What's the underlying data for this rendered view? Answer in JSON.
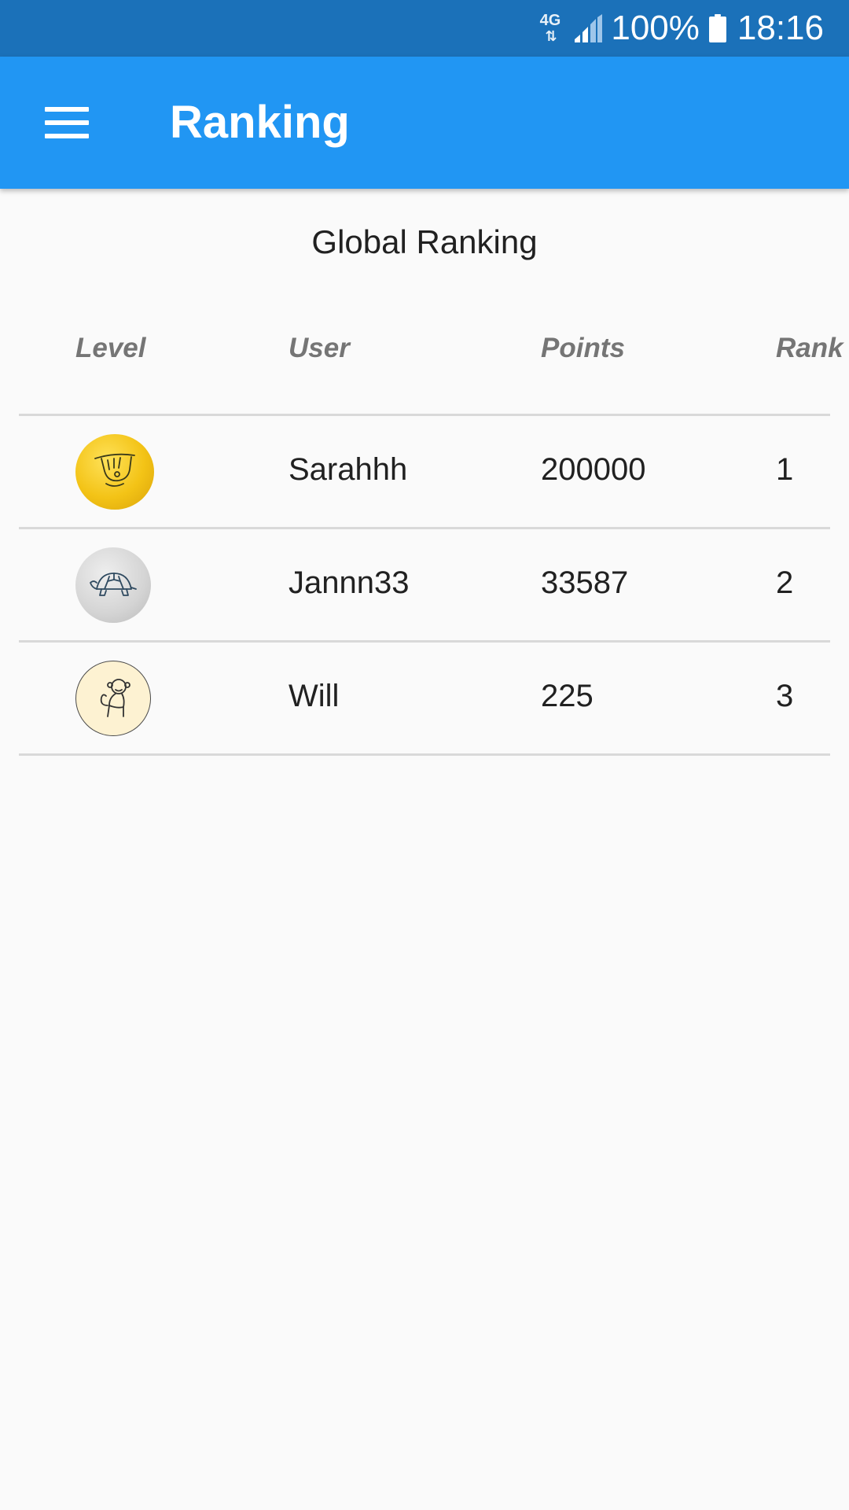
{
  "status_bar": {
    "network": "4G",
    "battery": "100%",
    "time": "18:16"
  },
  "app_bar": {
    "title": "Ranking",
    "menu_icon": "hamburger-menu-icon"
  },
  "section_title": "Global Ranking",
  "table": {
    "columns": [
      "Level",
      "User",
      "Points",
      "Rank"
    ],
    "rows": [
      {
        "level_icon": "sloth-icon",
        "level_color": "#f3c316",
        "user": "Sarahhh",
        "points": "200000",
        "rank": "1"
      },
      {
        "level_icon": "turtle-icon",
        "level_color": "#d4d4d4",
        "user": "Jannn33",
        "points": "33587",
        "rank": "2"
      },
      {
        "level_icon": "monkey-icon",
        "level_color": "#fdf2d2",
        "user": "Will",
        "points": "225",
        "rank": "3"
      }
    ]
  },
  "colors": {
    "status_bar": "#1b71b9",
    "app_bar": "#2196f3",
    "background": "#fafafa",
    "header_text": "#757575",
    "divider": "#d9d9d9"
  }
}
